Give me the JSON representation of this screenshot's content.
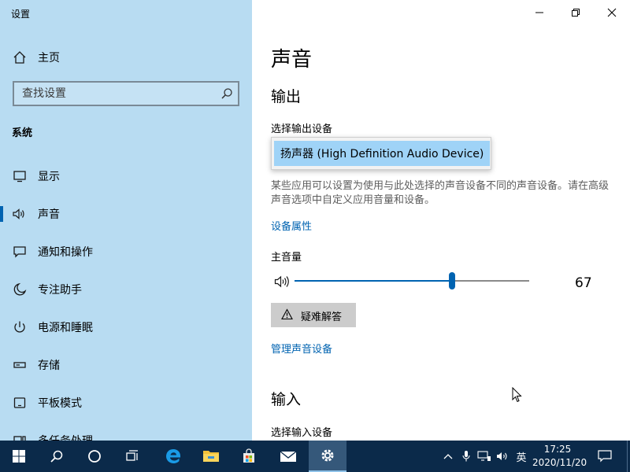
{
  "window": {
    "title": "设置"
  },
  "sidebar": {
    "home": "主页",
    "search_placeholder": "查找设置",
    "section": "系统",
    "items": [
      {
        "label": "显示",
        "icon": "display-icon"
      },
      {
        "label": "声音",
        "icon": "speaker-icon",
        "selected": true
      },
      {
        "label": "通知和操作",
        "icon": "notification-icon"
      },
      {
        "label": "专注助手",
        "icon": "moon-icon"
      },
      {
        "label": "电源和睡眠",
        "icon": "power-icon"
      },
      {
        "label": "存储",
        "icon": "storage-icon"
      },
      {
        "label": "平板模式",
        "icon": "tablet-icon"
      },
      {
        "label": "多任务处理",
        "icon": "multitask-icon"
      }
    ]
  },
  "main": {
    "title": "声音",
    "output": {
      "heading": "输出",
      "device_label": "选择输出设备",
      "selected_device": "扬声器 (High Definition Audio Device)",
      "description": "某些应用可以设置为使用与此处选择的声音设备不同的声音设备。请在高级声音选项中自定义应用音量和设备。",
      "device_properties_link": "设备属性",
      "volume_label": "主音量",
      "volume_value": 67,
      "volume_display": "67",
      "troubleshoot": "疑难解答",
      "manage_link": "管理声音设备"
    },
    "input": {
      "heading": "输入",
      "device_label": "选择输入设备"
    }
  },
  "taskbar": {
    "time": "17:25",
    "date": "2020/11/20",
    "ime": "英",
    "apps": [
      "start-icon",
      "search-icon",
      "cortana-icon",
      "task-view-icon",
      "edge-icon",
      "file-explorer-icon",
      "store-icon",
      "mail-icon",
      "settings-icon"
    ]
  },
  "colors": {
    "accent": "#0063b1",
    "sidebar_bg": "#b8dcf2",
    "taskbar_bg": "#0b2a4a",
    "selection": "#9fd3f7"
  }
}
